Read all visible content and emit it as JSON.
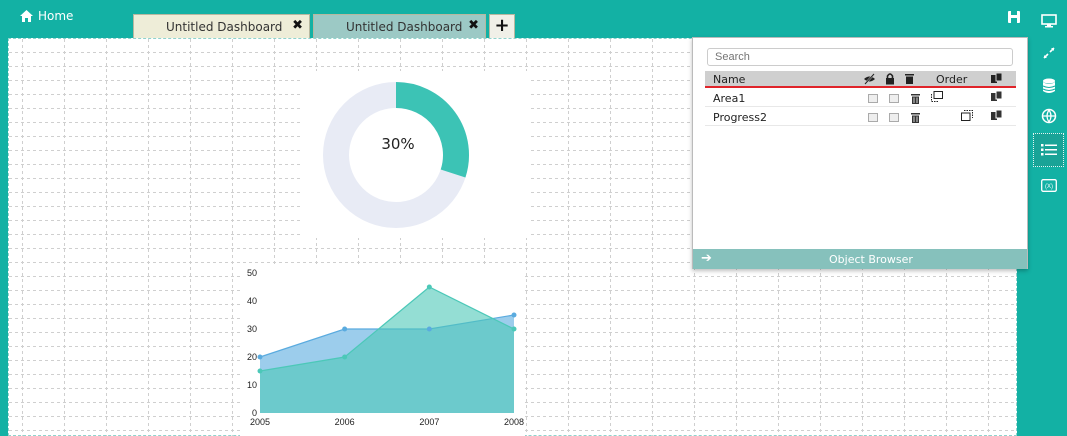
{
  "header": {
    "home_label": "Home",
    "tabs": [
      {
        "label": "Untitled Dashboard",
        "close": "✖"
      },
      {
        "label": "Untitled Dashboard",
        "close": "✖"
      }
    ],
    "add_tab": "+"
  },
  "toolbar": {
    "buttons": [
      "monitor-icon",
      "expand-icon",
      "database-icon",
      "globe-icon",
      "list-icon",
      "formula-icon"
    ]
  },
  "donut_widget": {
    "value_label": "30%",
    "percent": 30,
    "colors": {
      "fill": "#3cc3b5",
      "track": "#e8ebf5"
    }
  },
  "chart_data": {
    "type": "area",
    "x": [
      2005,
      2006,
      2007,
      2008
    ],
    "series": [
      {
        "values": [
          20,
          30,
          30,
          35
        ],
        "color": "#5aabdf"
      },
      {
        "values": [
          15,
          20,
          45,
          30
        ],
        "color": "#4cc8b8"
      }
    ],
    "ylim": [
      0,
      50
    ],
    "yticks": [
      0,
      10,
      20,
      30,
      40,
      50
    ],
    "xticks": [
      "2005",
      "2006",
      "2007",
      "2008"
    ],
    "grid": false
  },
  "object_browser": {
    "search_placeholder": "Search",
    "columns": {
      "name": "Name",
      "order": "Order"
    },
    "rows": [
      {
        "name": "Area1"
      },
      {
        "name": "Progress2"
      }
    ],
    "footer_title": "Object Browser"
  }
}
